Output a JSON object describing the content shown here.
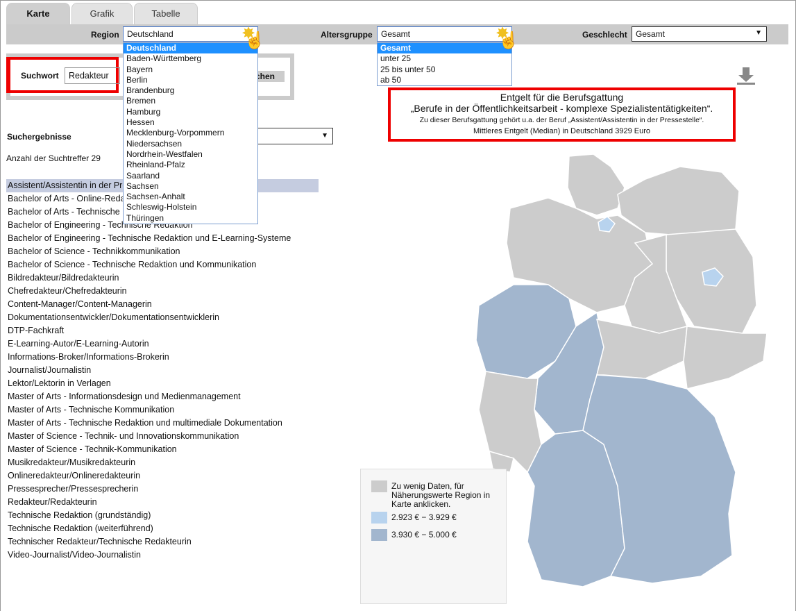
{
  "tabs": [
    {
      "label": "Karte",
      "active": true
    },
    {
      "label": "Grafik"
    },
    {
      "label": "Tabelle"
    }
  ],
  "filters": {
    "region_label": "Region",
    "region_value": "Deutschland",
    "region_options": [
      "Deutschland",
      "Baden-Württemberg",
      "Bayern",
      "Berlin",
      "Brandenburg",
      "Bremen",
      "Hamburg",
      "Hessen",
      "Mecklenburg-Vorpommern",
      "Niedersachsen",
      "Nordrhein-Westfalen",
      "Rheinland-Pfalz",
      "Saarland",
      "Sachsen",
      "Sachsen-Anhalt",
      "Schleswig-Holstein",
      "Thüringen"
    ],
    "age_label": "Altersgruppe",
    "age_value": "Gesamt",
    "age_options": [
      "Gesamt",
      "unter 25",
      "25 bis unter 50",
      "ab 50"
    ],
    "gender_label": "Geschlecht",
    "gender_value": "Gesamt"
  },
  "search": {
    "label": "Suchwort",
    "value": "Redakteur",
    "button": "Suchen"
  },
  "results": {
    "title": "Suchergebnisse",
    "count_text": "Anzahl der Suchtreffer 29",
    "items": [
      "Assistent/Assistentin in der Pressestelle",
      "Bachelor of Arts - Online-Redaktion",
      "Bachelor of Arts - Technische Redaktion und Projektmanagement",
      "Bachelor of Engineering - Technische Redaktion",
      "Bachelor of Engineering - Technische Redaktion und E-Learning-Systeme",
      "Bachelor of Science - Technikkommunikation",
      "Bachelor of Science - Technische Redaktion und Kommunikation",
      "Bildredakteur/Bildredakteurin",
      "Chefredakteur/Chefredakteurin",
      "Content-Manager/Content-Managerin",
      "Dokumentationsentwickler/Dokumentationsentwicklerin",
      "DTP-Fachkraft",
      "E-Learning-Autor/E-Learning-Autorin",
      "Informations-Broker/Informations-Brokerin",
      "Journalist/Journalistin",
      "Lektor/Lektorin in Verlagen",
      "Master of Arts - Informationsdesign und Medienmanagement",
      "Master of Arts - Technische Kommunikation",
      "Master of Arts - Technische Redaktion und multimediale Dokumentation",
      "Master of Science - Technik- und Innovationskommunikation",
      "Master of Science - Technik-Kommunikation",
      "Musikredakteur/Musikredakteurin",
      "Onlineredakteur/Onlineredakteurin",
      "Pressesprecher/Pressesprecherin",
      "Redakteur/Redakteurin",
      "Technische Redaktion (grundständig)",
      "Technische Redaktion (weiterführend)",
      "Technischer Redakteur/Technische Redakteurin",
      "Video-Journalist/Video-Journalistin"
    ]
  },
  "info": {
    "line1": "Entgelt für die Berufsgattung",
    "line2": "„Berufe in der Öffentlichkeitsarbeit - komplexe Spezialistentätigkeiten“.",
    "line3": "Zu dieser Berufsgattung gehört u.a. der Beruf „Assistent/Assistentin in der Pressestelle“.",
    "line4": "Mittleres Entgelt (Median) in Deutschland 3929 Euro"
  },
  "legend": [
    {
      "label": "Zu wenig Daten, für Näherungswerte Region in Karte anklicken.",
      "color": "#cccccc"
    },
    {
      "label": "2.923 € − 3.929 €",
      "color": "#b8d3ee"
    },
    {
      "label": "3.930 € − 5.000 €",
      "color": "#a2b6ce"
    }
  ],
  "icons": {
    "download": "download-icon",
    "cursor": "hand-pointer-icon"
  }
}
